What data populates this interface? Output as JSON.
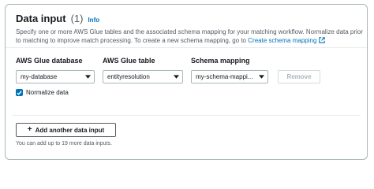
{
  "header": {
    "title": "Data input",
    "count": "(1)",
    "info_link": "Info",
    "description": "Specify one or more AWS Glue tables and the associated schema mapping for your matching workflow. Normalize data prior to matching to improve match processing. To create a new schema mapping, go to",
    "description_link": "Create schema mapping"
  },
  "input_row": {
    "database_label": "AWS Glue database",
    "database_value": "my-database",
    "table_label": "AWS Glue table",
    "table_value": "entityresolution",
    "schema_label": "Schema mapping",
    "schema_value": "my-schema-mappi...",
    "remove_label": "Remove"
  },
  "normalize": {
    "label": "Normalize data",
    "checked": true
  },
  "add_button": {
    "label": "Add another data input"
  },
  "hint": "You can add up to 19 more data inputs.",
  "colors": {
    "link": "#0073bb",
    "checkbox": "#0073bb",
    "border": "#aab7b8"
  },
  "icons": [
    "external-link-icon",
    "caret-down-icon",
    "checkmark-icon",
    "plus-icon"
  ]
}
